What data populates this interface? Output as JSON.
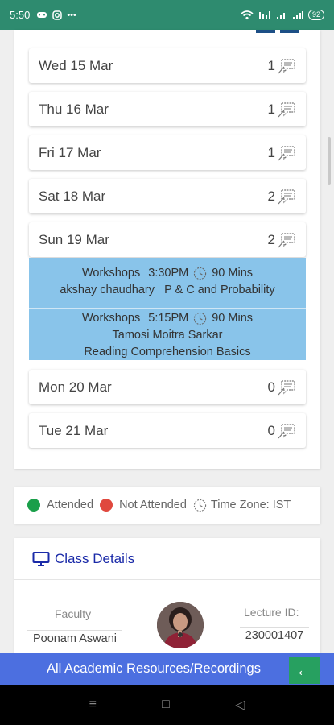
{
  "status_bar": {
    "time": "5:50",
    "battery": "92",
    "left_icons": [
      "gamepad-icon",
      "instagram-icon",
      "more-icon"
    ],
    "right_icons": [
      "wifi-icon",
      "vo-lte-icon",
      "signal-icon",
      "signal-icon"
    ]
  },
  "schedule": {
    "days": [
      {
        "label": "Wed 15 Mar",
        "count": "1"
      },
      {
        "label": "Thu 16 Mar",
        "count": "1"
      },
      {
        "label": "Fri 17 Mar",
        "count": "1"
      },
      {
        "label": "Sat 18 Mar",
        "count": "2"
      },
      {
        "label": "Sun 19 Mar",
        "count": "2"
      },
      {
        "label": "Mon 20 Mar",
        "count": "0"
      },
      {
        "label": "Tue 21 Mar",
        "count": "0"
      }
    ],
    "sessions": [
      {
        "type": "Workshops",
        "time": "3:30PM",
        "duration": "90 Mins",
        "faculty_topic": "akshay chaudhary   P & C and Probability"
      },
      {
        "type": "Workshops",
        "time": "5:15PM",
        "duration": "90 Mins",
        "faculty": "Tamosi Moitra Sarkar",
        "topic": "Reading Comprehension Basics"
      }
    ],
    "session_color": "#89c4ea"
  },
  "legend": {
    "attended": "Attended",
    "attended_color": "#1a9f4a",
    "not_attended": "Not Attended",
    "not_attended_color": "#e0483e",
    "timezone": "Time Zone: IST"
  },
  "class_details": {
    "title": "Class Details",
    "faculty_label": "Faculty",
    "faculty_name": "Poonam Aswani",
    "lecture_label": "Lecture ID:",
    "lecture_id": "230001407"
  },
  "banner": {
    "text": "All Academic Resources/Recordings",
    "arrow": "←"
  },
  "nav": {
    "menu": "≡",
    "home": "□",
    "back": "◁"
  }
}
